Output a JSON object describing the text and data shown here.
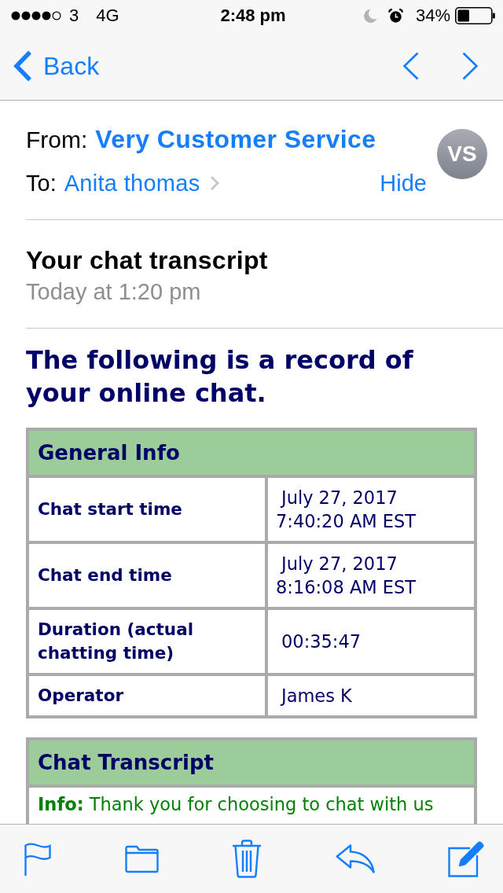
{
  "status_bar": {
    "carrier": "3",
    "network": "4G",
    "time": "2:48 pm",
    "battery_percent": "34%"
  },
  "nav_bar": {
    "back_label": "Back"
  },
  "header": {
    "from_label": "From:",
    "sender": "Very Customer Service",
    "avatar_initials": "VS",
    "to_label": "To:",
    "recipient": "Anita thomas",
    "hide_label": "Hide"
  },
  "message": {
    "subject": "Your chat transcript",
    "date": "Today at 1:20 pm"
  },
  "body": {
    "heading": "The following is a record of your online chat.",
    "general_info": {
      "title": "General Info",
      "rows": [
        {
          "label": "Chat start time",
          "value": "July 27, 2017 7:40:20 AM EST"
        },
        {
          "label": "Chat end time",
          "value": "July 27, 2017 8:16:08 AM EST"
        },
        {
          "label": "Duration (actual chatting time)",
          "value": "00:35:47"
        },
        {
          "label": "Operator",
          "value": "James K"
        }
      ]
    },
    "transcript": {
      "title": "Chat Transcript",
      "messages": [
        "**Info:** Thank you for choosing to chat with us"
      ]
    }
  }
}
